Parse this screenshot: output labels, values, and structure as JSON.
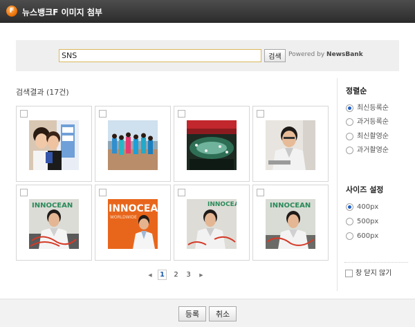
{
  "window": {
    "title": "뉴스뱅크F 이미지 첨부",
    "logo_glyph": "F"
  },
  "search": {
    "value": "SNS",
    "button_label": "검색",
    "powered_prefix": "Powered by",
    "powered_brand": "NewsBank"
  },
  "results": {
    "title": "검색결과 (17건)",
    "items": [
      {
        "name": "result-image-1",
        "selected": false
      },
      {
        "name": "result-image-2",
        "selected": false
      },
      {
        "name": "result-image-3",
        "selected": false
      },
      {
        "name": "result-image-4",
        "selected": false
      },
      {
        "name": "result-image-5",
        "selected": false
      },
      {
        "name": "result-image-6",
        "selected": false
      },
      {
        "name": "result-image-7",
        "selected": false
      },
      {
        "name": "result-image-8",
        "selected": false
      }
    ]
  },
  "pagination": {
    "prev": "◀",
    "next": "▶",
    "pages": [
      "1",
      "2",
      "3"
    ],
    "current": "1"
  },
  "sort": {
    "title": "정렬순",
    "options": [
      "최신등록순",
      "과거등록순",
      "최신촬영순",
      "과거촬영순"
    ],
    "selected": "최신등록순"
  },
  "size": {
    "title": "사이즈 설정",
    "options": [
      "400px",
      "500px",
      "600px"
    ],
    "selected": "400px"
  },
  "keep_open": {
    "label": "창 닫지 않기",
    "checked": false
  },
  "footer": {
    "submit_label": "등록",
    "cancel_label": "취소"
  },
  "colors": {
    "accent": "#1e5ec7",
    "titlebar": "#3a3a3a",
    "input_border": "#d8b659",
    "search_highlight": "#3a78d4"
  }
}
